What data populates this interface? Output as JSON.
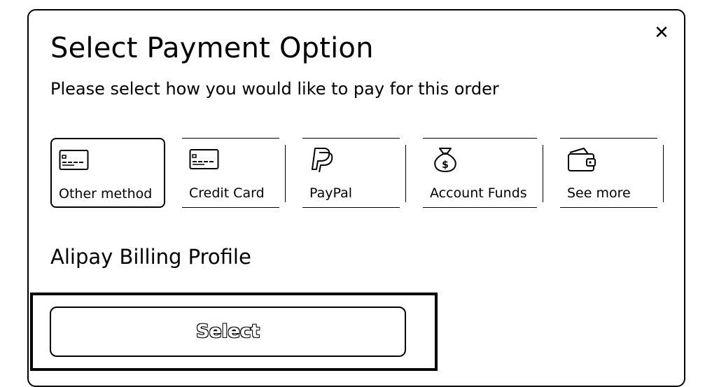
{
  "dialog": {
    "title": "Select Payment Option",
    "subtitle": "Please select how you would like to pay for this order",
    "close_icon": "close-icon"
  },
  "payment_options": [
    {
      "label": "Other method",
      "icon": "credit-card-icon",
      "selected": true
    },
    {
      "label": "Credit Card",
      "icon": "credit-card-icon",
      "selected": false
    },
    {
      "label": "PayPal",
      "icon": "paypal-icon",
      "selected": false
    },
    {
      "label": "Account Funds",
      "icon": "money-bag-icon",
      "selected": false
    },
    {
      "label": "See more",
      "icon": "wallet-icon",
      "selected": false
    }
  ],
  "section": {
    "heading": "Alipay Billing Profile"
  },
  "actions": {
    "select_label": "Select"
  }
}
